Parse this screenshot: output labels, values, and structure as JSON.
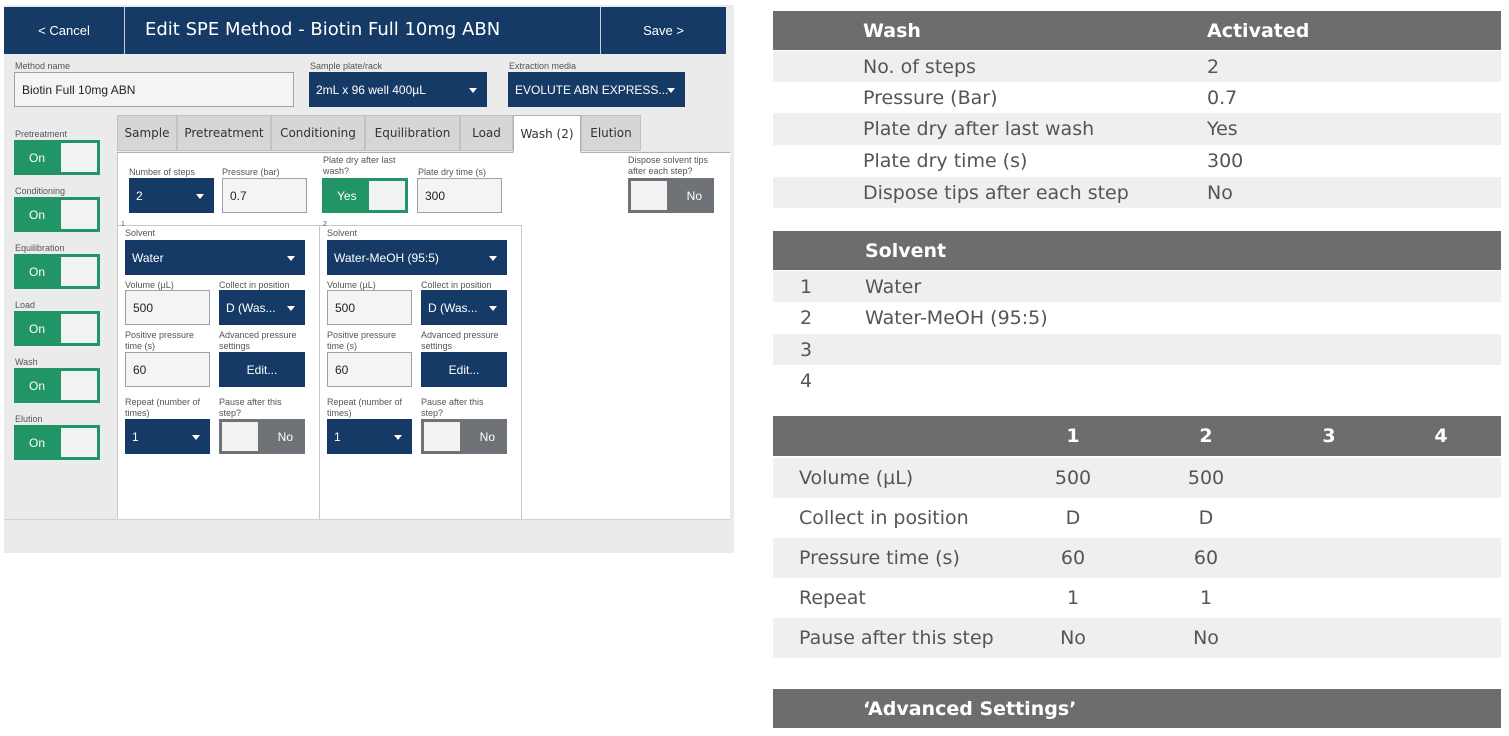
{
  "app": {
    "topbar": {
      "cancel_label": "< Cancel",
      "title": "Edit SPE Method - Biotin Full 10mg ABN",
      "save_label": "Save >"
    },
    "method_name": {
      "label": "Method name",
      "value": "Biotin Full 10mg ABN"
    },
    "sample_plate": {
      "label": "Sample plate/rack",
      "value": "2mL x 96 well 400µL"
    },
    "extraction_media": {
      "label": "Extraction media",
      "value": "EVOLUTE ABN EXPRESS..."
    },
    "sidebar": [
      {
        "label": "Pretreatment",
        "state": "On"
      },
      {
        "label": "Conditioning",
        "state": "On"
      },
      {
        "label": "Equilibration",
        "state": "On"
      },
      {
        "label": "Load",
        "state": "On"
      },
      {
        "label": "Wash",
        "state": "On"
      },
      {
        "label": "Elution",
        "state": "On"
      }
    ],
    "tabs": [
      "Sample",
      "Pretreatment",
      "Conditioning",
      "Equilibration",
      "Load",
      "Wash (2)",
      "Elution"
    ],
    "active_tab": "Wash (2)",
    "wash": {
      "steps_label": "Number of steps",
      "steps_value": "2",
      "pressure_label": "Pressure (bar)",
      "pressure_value": "0.7",
      "plate_dry_label": "Plate dry after last wash?",
      "plate_dry_state": "Yes",
      "plate_dry_time_label": "Plate dry time (s)",
      "plate_dry_time_value": "300",
      "dispose_label": "Dispose solvent tips after each step?",
      "dispose_state": "No"
    },
    "steps": [
      {
        "num": "1",
        "solvent_label": "Solvent",
        "solvent": "Water",
        "volume_label": "Volume (µL)",
        "volume": "500",
        "collect_label": "Collect in position",
        "collect": "D (Was...",
        "ppt_label": "Positive pressure time (s)",
        "ppt": "60",
        "adv_label": "Advanced pressure settings",
        "adv_button": "Edit...",
        "repeat_label": "Repeat (number of times)",
        "repeat": "1",
        "pause_label": "Pause after this step?",
        "pause_state": "No"
      },
      {
        "num": "2",
        "solvent_label": "Solvent",
        "solvent": "Water-MeOH (95:5)",
        "volume_label": "Volume (µL)",
        "volume": "500",
        "collect_label": "Collect in position",
        "collect": "D (Was...",
        "ppt_label": "Positive pressure time (s)",
        "ppt": "60",
        "adv_label": "Advanced pressure settings",
        "adv_button": "Edit...",
        "repeat_label": "Repeat (number of times)",
        "repeat": "1",
        "pause_label": "Pause after this step?",
        "pause_state": "No"
      }
    ]
  },
  "summary": {
    "wash_table": {
      "header": [
        "Wash",
        "Activated"
      ],
      "rows": [
        [
          "No. of steps",
          "2"
        ],
        [
          "Pressure (Bar)",
          "0.7"
        ],
        [
          "Plate dry after last wash",
          "Yes"
        ],
        [
          "Plate dry time (s)",
          "300"
        ],
        [
          "Dispose tips after each step",
          "No"
        ]
      ]
    },
    "solvent_table": {
      "header": "Solvent",
      "rows": [
        [
          "1",
          "Water"
        ],
        [
          "2",
          "Water-MeOH (95:5)"
        ],
        [
          "3",
          ""
        ],
        [
          "4",
          ""
        ]
      ]
    },
    "steps_table": {
      "header": [
        "1",
        "2",
        "3",
        "4"
      ],
      "rows": [
        [
          "Volume (µL)",
          "500",
          "500",
          "",
          ""
        ],
        [
          "Collect in position",
          "D",
          "D",
          "",
          ""
        ],
        [
          "Pressure time (s)",
          "60",
          "60",
          "",
          ""
        ],
        [
          "Repeat",
          "1",
          "1",
          "",
          ""
        ],
        [
          "Pause after this step",
          "No",
          "No",
          "",
          ""
        ]
      ]
    },
    "advanced_header": "‘Advanced Settings’"
  },
  "colors": {
    "navy": "#163a66",
    "green_on": "#219566",
    "grey_off": "#6f7378",
    "table_header": "#6d6d6d"
  }
}
